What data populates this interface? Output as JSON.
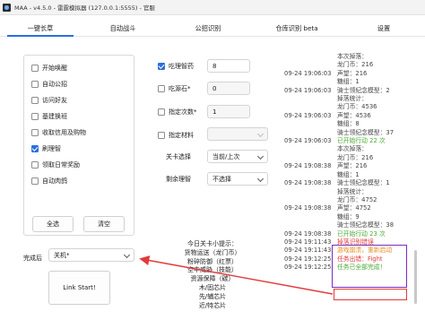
{
  "window": {
    "title": "MAA - v4.5.0 - 雷霆模拟器 (127.0.0.1:5555) - 官服"
  },
  "tabs": [
    {
      "label": "一键长草",
      "active": true
    },
    {
      "label": "自动战斗"
    },
    {
      "label": "公招识别"
    },
    {
      "label": "仓库识别 beta"
    },
    {
      "label": "设置"
    }
  ],
  "tasks": {
    "items": [
      {
        "label": "开始唤醒",
        "checked": false
      },
      {
        "label": "自动公招",
        "checked": false
      },
      {
        "label": "访问好友",
        "checked": false
      },
      {
        "label": "基建换班",
        "checked": false
      },
      {
        "label": "收取信用及购物",
        "checked": false
      },
      {
        "label": "刷理智",
        "checked": true
      },
      {
        "label": "领取日常奖励",
        "checked": false
      },
      {
        "label": "自动肉鸽",
        "checked": false
      }
    ],
    "select_all": "全选",
    "clear": "清空"
  },
  "finish": {
    "label": "完成后",
    "value": "关机*"
  },
  "link_start": "Link Start!",
  "settings": {
    "use_sanity_potion": {
      "label": "吃理智药",
      "checked": true,
      "value": "8"
    },
    "use_originium": {
      "label": "吃源石*",
      "checked": false,
      "value": "0"
    },
    "specify_times": {
      "label": "指定次数*",
      "checked": false,
      "value": "1"
    },
    "specify_material": {
      "label": "指定材料",
      "checked": false,
      "value": ""
    },
    "stage_select": {
      "label": "关卡选择",
      "value": "当前/上次"
    },
    "remaining_sanity": {
      "label": "剩余理智",
      "value": "不选择"
    }
  },
  "hint": {
    "lines": [
      "今日关卡小提示：",
      "货物运送（龙门币）",
      "粉碎防御（红票）",
      "空中威胁（技能）",
      "资源保障（碳）",
      "木/固芯片",
      "先/辅芯片",
      "近/特芯片"
    ]
  },
  "log": [
    {
      "text": "本次掉落：",
      "indent": true
    },
    {
      "text": "龙门币：216",
      "indent": true
    },
    {
      "ts": "09-24 19:06:03",
      "text": "声望：216"
    },
    {
      "text": "糖组：1",
      "indent": true
    },
    {
      "ts": "09-24 19:06:03",
      "text": "骑士领纪念模型：2"
    },
    {
      "text": "掉落统计：",
      "indent": true
    },
    {
      "text": "龙门币：4536",
      "indent": true
    },
    {
      "ts": "09-24 19:06:03",
      "text": "声望：4536"
    },
    {
      "text": "糖组：8",
      "indent": true
    },
    {
      "text": "骑士领纪念模型：37",
      "indent": true
    },
    {
      "ts": "09-24 19:06:03",
      "text": "已开始行动 22 次",
      "color": "green"
    },
    {
      "text": "本次掉落：",
      "indent": true
    },
    {
      "text": "龙门币：216",
      "indent": true
    },
    {
      "ts": "09-24 19:08:38",
      "text": "声望：216"
    },
    {
      "text": "糖组：1",
      "indent": true
    },
    {
      "ts": "09-24 19:08:38",
      "text": "骑士领纪念模型：1"
    },
    {
      "text": "掉落统计：",
      "indent": true
    },
    {
      "text": "龙门币：4752",
      "indent": true
    },
    {
      "ts": "09-24 19:08:38",
      "text": "声望：4752"
    },
    {
      "text": "糖组：9",
      "indent": true
    },
    {
      "text": "骑士领纪念模型：38",
      "indent": true
    },
    {
      "ts": "09-24 19:08:38",
      "text": "已开始行动 23 次",
      "color": "green"
    },
    {
      "ts": "09-24 19:11:43",
      "text": "掉落识别错误",
      "color": "red"
    },
    {
      "ts": "09-24 19:11:43",
      "text": "游戏崩溃，重新启动",
      "color": "orange"
    },
    {
      "ts": "09-24 19:12:25",
      "text": "任务出错：Fight",
      "color": "red"
    },
    {
      "ts": "09-24 19:12:25",
      "text": "任务已全部完成！",
      "color": "green"
    }
  ],
  "colors": {
    "accent": "#2a6fdb",
    "annotation_purple": "#7a2bc4",
    "annotation_red": "#e23a3a",
    "log_green": "#4aa832",
    "log_orange": "#e8891d",
    "log_red": "#e23a3a"
  }
}
